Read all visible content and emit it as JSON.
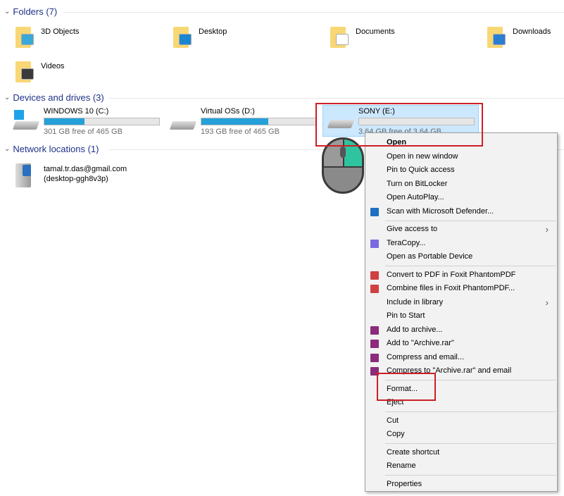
{
  "folders": {
    "title": "Folders (7)",
    "items": [
      {
        "name": "3D Objects",
        "icon": "3d-objects-folder-icon",
        "color": "#3aa8d8"
      },
      {
        "name": "Desktop",
        "icon": "desktop-folder-icon",
        "color": "#1a86d0"
      },
      {
        "name": "Documents",
        "icon": "documents-folder-icon",
        "color": "#ffffff"
      },
      {
        "name": "Downloads",
        "icon": "downloads-folder-icon",
        "color": "#2a7fd4"
      },
      {
        "name": "Videos",
        "icon": "videos-folder-icon",
        "color": "#3a3a3a"
      }
    ]
  },
  "drives": {
    "title": "Devices and drives (3)",
    "items": [
      {
        "name": "WINDOWS 10 (C:)",
        "free": "301 GB free of 465 GB",
        "used_percent": 35
      },
      {
        "name": "Virtual OSs (D:)",
        "free": "193 GB free of 465 GB",
        "used_percent": 58
      },
      {
        "name": "SONY (E:)",
        "free": "3.64 GB free of 3.64 GB",
        "used_percent": 0,
        "selected": true
      }
    ]
  },
  "network": {
    "title": "Network locations (1)",
    "items": [
      {
        "line1": "tamal.tr.das@gmail.com",
        "line2": "(desktop-ggh8v3p)"
      }
    ]
  },
  "menu": {
    "items": [
      {
        "label": "Open",
        "bold": true
      },
      {
        "label": "Open in new window"
      },
      {
        "label": "Pin to Quick access"
      },
      {
        "label": "Turn on BitLocker"
      },
      {
        "label": "Open AutoPlay..."
      },
      {
        "label": "Scan with Microsoft Defender...",
        "icon": "defender-icon"
      },
      {
        "sep": true
      },
      {
        "label": "Give access to",
        "submenu": true
      },
      {
        "label": "TeraCopy...",
        "icon": "teracopy-icon"
      },
      {
        "label": "Open as Portable Device"
      },
      {
        "sep": true
      },
      {
        "label": "Convert to PDF in Foxit PhantomPDF",
        "icon": "foxit-icon"
      },
      {
        "label": "Combine files in Foxit PhantomPDF...",
        "icon": "foxit-icon"
      },
      {
        "label": "Include in library",
        "submenu": true
      },
      {
        "label": "Pin to Start"
      },
      {
        "label": "Add to archive...",
        "icon": "winrar-icon"
      },
      {
        "label": "Add to \"Archive.rar\"",
        "icon": "winrar-icon"
      },
      {
        "label": "Compress and email...",
        "icon": "winrar-icon"
      },
      {
        "label": "Compress to \"Archive.rar\" and email",
        "icon": "winrar-icon"
      },
      {
        "sep": true
      },
      {
        "label": "Format..."
      },
      {
        "label": "Eject"
      },
      {
        "sep": true
      },
      {
        "label": "Cut"
      },
      {
        "label": "Copy"
      },
      {
        "sep": true
      },
      {
        "label": "Create shortcut"
      },
      {
        "label": "Rename"
      },
      {
        "sep": true
      },
      {
        "label": "Properties"
      }
    ]
  },
  "colors": {
    "accent": "#26a0da",
    "highlight": "#cce8ff",
    "annotation": "#cc1f26"
  }
}
